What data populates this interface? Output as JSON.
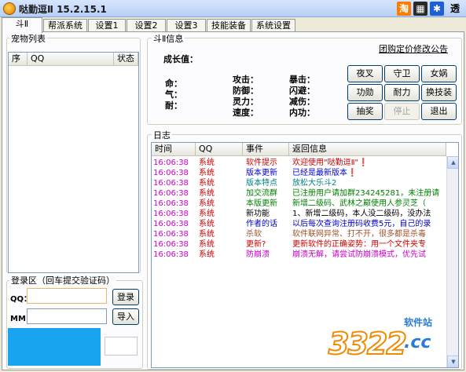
{
  "window": {
    "title": "哒勤逗Ⅱ  15.2.15.1",
    "icons": [
      {
        "name": "taobao-icon",
        "glyph": "淘",
        "bg": "#ff7a00",
        "fg": "#ffffff"
      },
      {
        "name": "film-icon",
        "glyph": "▦",
        "bg": "#2a2a2a",
        "fg": "#ffffff"
      },
      {
        "name": "paw-icon",
        "glyph": "✱",
        "bg": "#1e5fd8",
        "fg": "#ffffff"
      },
      {
        "name": "transparent-toggle",
        "glyph": "透",
        "bg": "transparent",
        "fg": "#000000"
      }
    ]
  },
  "tabs": [
    "斗Ⅱ",
    "帮派系统",
    "设置1",
    "设置2",
    "设置3",
    "技能装备",
    "系统设置"
  ],
  "pet_list": {
    "title": "宠物列表",
    "columns": [
      "序",
      "QQ",
      "状态"
    ]
  },
  "info": {
    "title": "斗Ⅱ信息",
    "group_buy_link": "团购定价修改公告",
    "growth_label": "成长值：",
    "left_stats": [
      "命：",
      "气：",
      "耐："
    ],
    "mid_stats": [
      "攻击：",
      "防御：",
      "灵力：",
      "速度："
    ],
    "right_stats": [
      "暴击：",
      "闪避：",
      "减伤：",
      "内功："
    ]
  },
  "action_buttons": [
    {
      "label": "夜叉",
      "enabled": true
    },
    {
      "label": "守卫",
      "enabled": true
    },
    {
      "label": "女娲",
      "enabled": true
    },
    {
      "label": "功勋",
      "enabled": true
    },
    {
      "label": "耐力",
      "enabled": true
    },
    {
      "label": "换技装",
      "enabled": true
    },
    {
      "label": "抽奖",
      "enabled": true
    },
    {
      "label": "停止",
      "enabled": false
    },
    {
      "label": "退出",
      "enabled": true
    }
  ],
  "log": {
    "title": "日志",
    "columns": [
      "时间",
      "QQ",
      "事件",
      "返回信息"
    ],
    "rows": [
      {
        "time": "16:06:38",
        "qq": "系统",
        "event": "软件提示",
        "msg": "欢迎使用\"哒勤逗Ⅱ\"❗",
        "color": "#cc0000"
      },
      {
        "time": "16:06:38",
        "qq": "系统",
        "event": "版本更新",
        "msg": "已经是最新版本❗",
        "color": "#0000cc"
      },
      {
        "time": "16:06:38",
        "qq": "系统",
        "event": "版本特点",
        "msg": "放松大乐斗2",
        "color": "#008080"
      },
      {
        "time": "16:06:38",
        "qq": "系统",
        "event": "加交流群",
        "msg": "已注册用户请加群234245281，未注册请",
        "color": "#008000"
      },
      {
        "time": "16:06:38",
        "qq": "系统",
        "event": "本版更新",
        "msg": "新增二级码、武林之巅使用人参灵芝（",
        "color": "#008000"
      },
      {
        "time": "16:06:38",
        "qq": "系统",
        "event": "新功能",
        "msg": "1、新增二级码，本人没二级码，没办法",
        "color": "#000000"
      },
      {
        "time": "16:06:38",
        "qq": "系统",
        "event": "作者的话",
        "msg": "以后每次查询注册码收费5元，自己的录",
        "color": "#0000cc"
      },
      {
        "time": "16:06:38",
        "qq": "系统",
        "event": "杀软",
        "msg": "软件联网异常、打不开，很多都是杀毒",
        "color": "#a0522d"
      },
      {
        "time": "16:06:38",
        "qq": "系统",
        "event": "更新?",
        "msg": "更新软件的正确姿势：用一个文件夹专",
        "color": "#cc0000"
      },
      {
        "time": "16:06:38",
        "qq": "系统",
        "event": "防崩溃",
        "msg": "崩溃无解，请尝试防崩溃模式，优先试",
        "color": "#cc00cc"
      }
    ]
  },
  "login": {
    "title": "登录区（回车提交验证码）",
    "qq_label": "QQ：",
    "pwd_label": "MM：",
    "login_button": "登录",
    "import_button": "导入"
  },
  "watermark": {
    "brand": "3322",
    "suffix": ".cc",
    "tag": "软件站"
  }
}
